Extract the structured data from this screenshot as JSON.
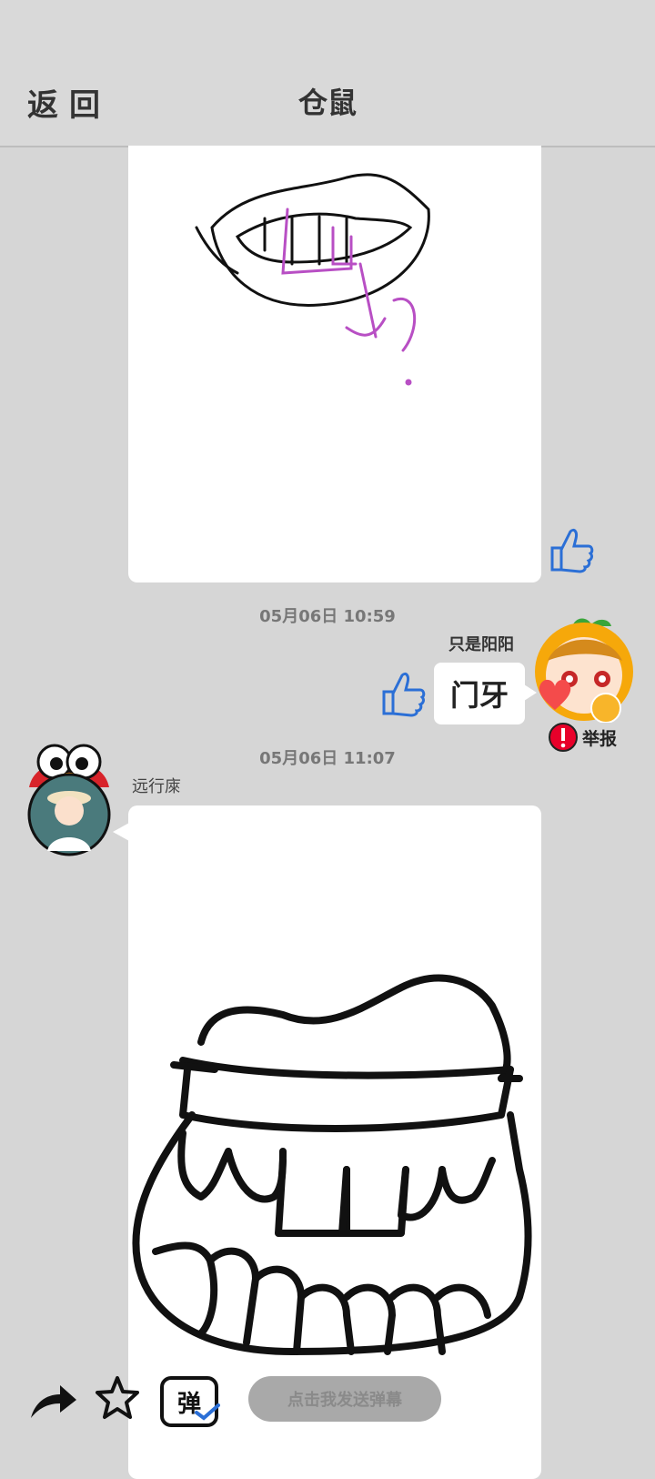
{
  "header": {
    "back_label": "返回",
    "title": "仓鼠"
  },
  "messages": [
    {
      "type": "image",
      "description_icon": "drawing-lips-teeth",
      "liked": true
    },
    {
      "timestamp": "05月06日  10:59",
      "user": "只是阳阳",
      "text": "门牙",
      "report_label": "举报"
    },
    {
      "timestamp": "05月06日  11:07",
      "user": "远行庲",
      "type": "image"
    }
  ],
  "bottom": {
    "danmaku_placeholder": "点击我发送弹幕",
    "danmaku_icon_text": "弹"
  },
  "colors": {
    "background": "#d6d6d6",
    "accent_blue": "#2b6fd6",
    "report_red": "#e8002a"
  }
}
